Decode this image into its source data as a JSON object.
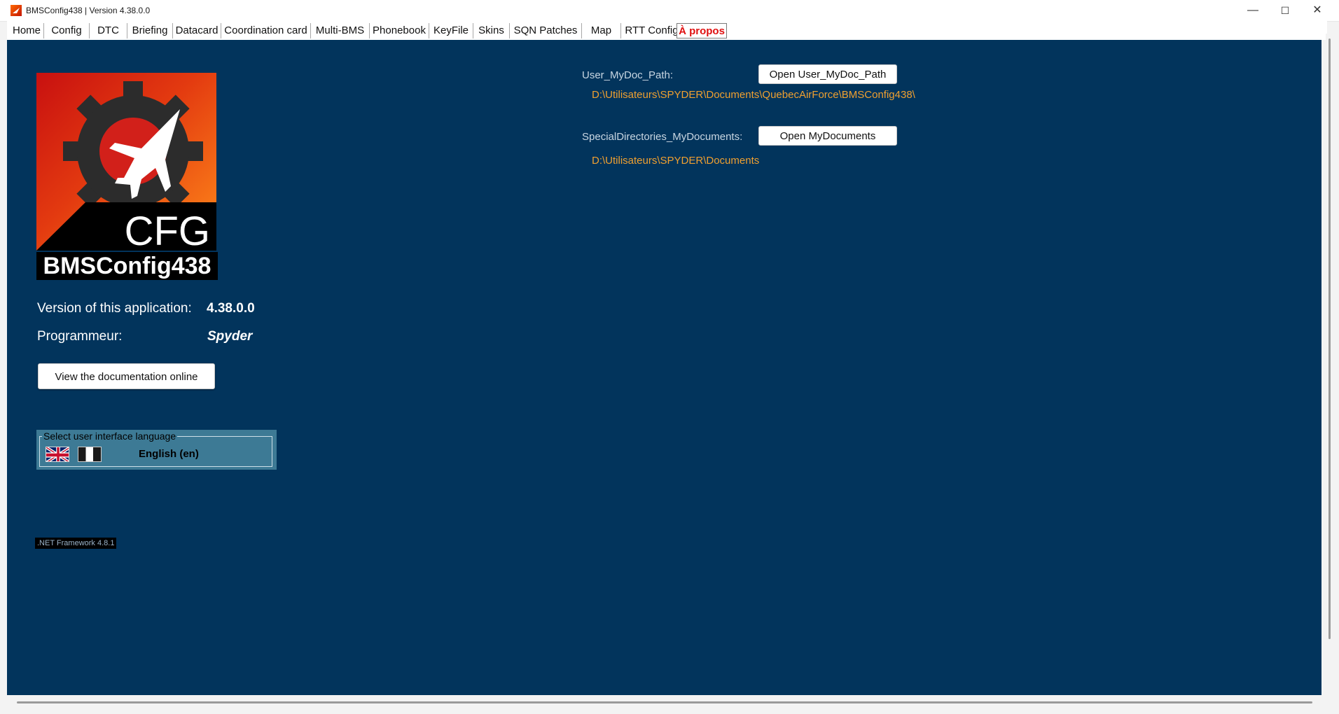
{
  "window": {
    "title": "BMSConfig438 | Version 4.38.0.0",
    "controls": {
      "minimize": "—",
      "maximize": "☐",
      "close": "✕"
    }
  },
  "tabs": [
    {
      "label": "Home"
    },
    {
      "label": "Config"
    },
    {
      "label": "DTC"
    },
    {
      "label": "Briefing"
    },
    {
      "label": "Datacard"
    },
    {
      "label": "Coordination card"
    },
    {
      "label": "Multi-BMS"
    },
    {
      "label": "Phonebook"
    },
    {
      "label": "KeyFile"
    },
    {
      "label": "Skins"
    },
    {
      "label": "SQN Patches"
    },
    {
      "label": "Map"
    },
    {
      "label": "RTT Config"
    },
    {
      "label": "À propos",
      "active": true
    }
  ],
  "about": {
    "logo": {
      "mark": "CFG",
      "name": "BMSConfig438"
    },
    "version_label": "Version of this application:",
    "version_value": "4.38.0.0",
    "programmer_label": "Programmeur:",
    "programmer_value": "Spyder",
    "doc_button": "View the documentation online",
    "language": {
      "legend": "Select user interface language",
      "current": "English (en)",
      "flags": [
        "uk-flag-icon",
        "fr-flag-icon"
      ]
    },
    "framework": ".NET Framework 4.8.1"
  },
  "paths": {
    "user_mydoc": {
      "label": "User_MyDoc_Path:",
      "button": "Open User_MyDoc_Path",
      "value": "D:\\Utilisateurs\\SPYDER\\Documents\\QuebecAirForce\\BMSConfig438\\"
    },
    "mydocuments": {
      "label": "SpecialDirectories_MyDocuments:",
      "button": "Open MyDocuments",
      "value": "D:\\Utilisateurs\\SPYDER\\Documents"
    }
  },
  "colors": {
    "content_bg": "#02345c",
    "path_value": "#f0a030",
    "active_tab": "#e01010",
    "language_panel": "#3d7a95"
  }
}
